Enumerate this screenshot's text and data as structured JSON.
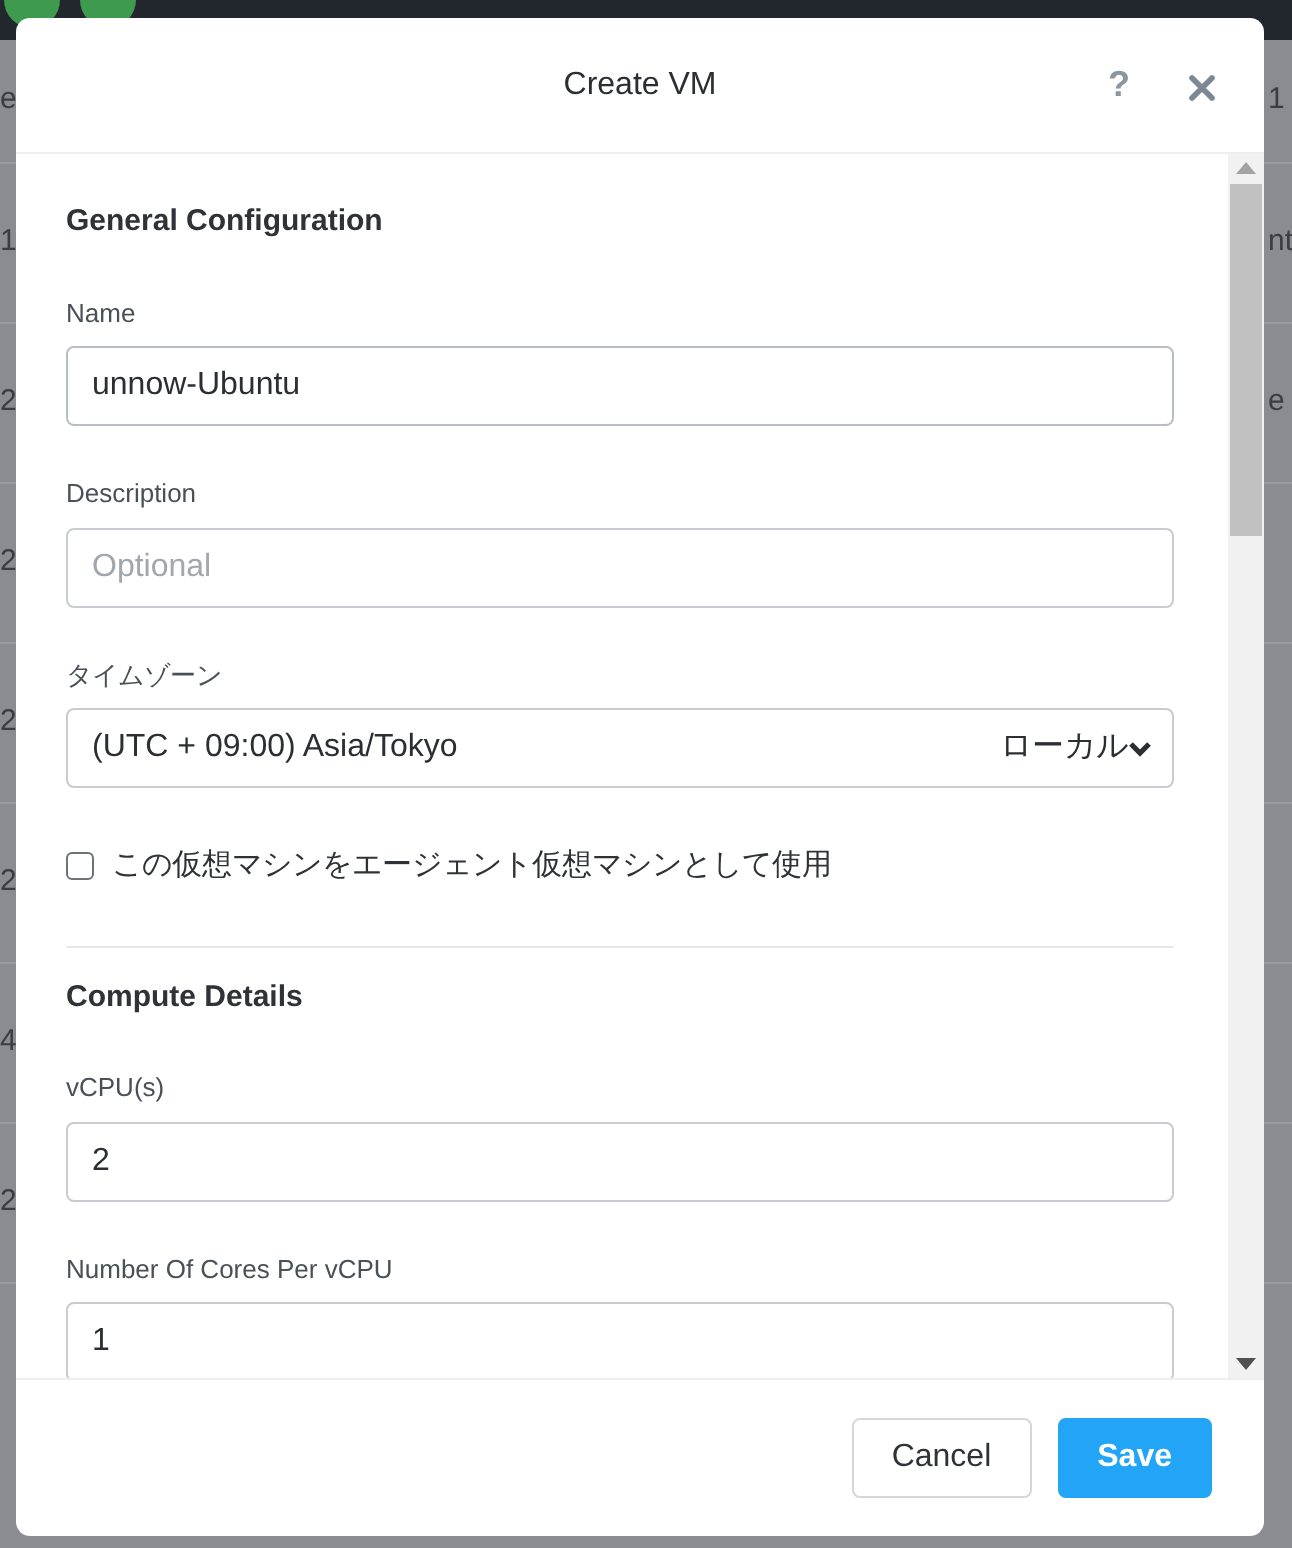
{
  "background": {
    "right_texts": [
      "1",
      "nt",
      "e"
    ],
    "left_texts": [
      "e",
      "1",
      "2",
      "2",
      "2",
      "2",
      "4",
      "2"
    ]
  },
  "dialog": {
    "title": "Create VM",
    "help": "?",
    "sections": [
      {
        "heading": "General Configuration",
        "fields": [
          {
            "kind": "text",
            "label": "Name",
            "value": "unnow-Ubuntu",
            "focused": true
          },
          {
            "kind": "text",
            "label": "Description",
            "placeholder": "Optional"
          },
          {
            "kind": "select",
            "label": "タイムゾーン",
            "value": "(UTC + 09:00) Asia/Tokyo",
            "suffix": "ローカル"
          },
          {
            "kind": "checkbox",
            "label": "この仮想マシンをエージェント仮想マシンとして使用",
            "checked": false
          }
        ]
      },
      {
        "heading": "Compute Details",
        "fields": [
          {
            "kind": "text",
            "label": "vCPU(s)",
            "value": "2"
          },
          {
            "kind": "text",
            "label": "Number Of Cores Per vCPU",
            "value": "1"
          }
        ]
      }
    ],
    "buttons": [
      {
        "label": "Cancel",
        "kind": "secondary"
      },
      {
        "label": "Save",
        "kind": "primary"
      }
    ]
  }
}
